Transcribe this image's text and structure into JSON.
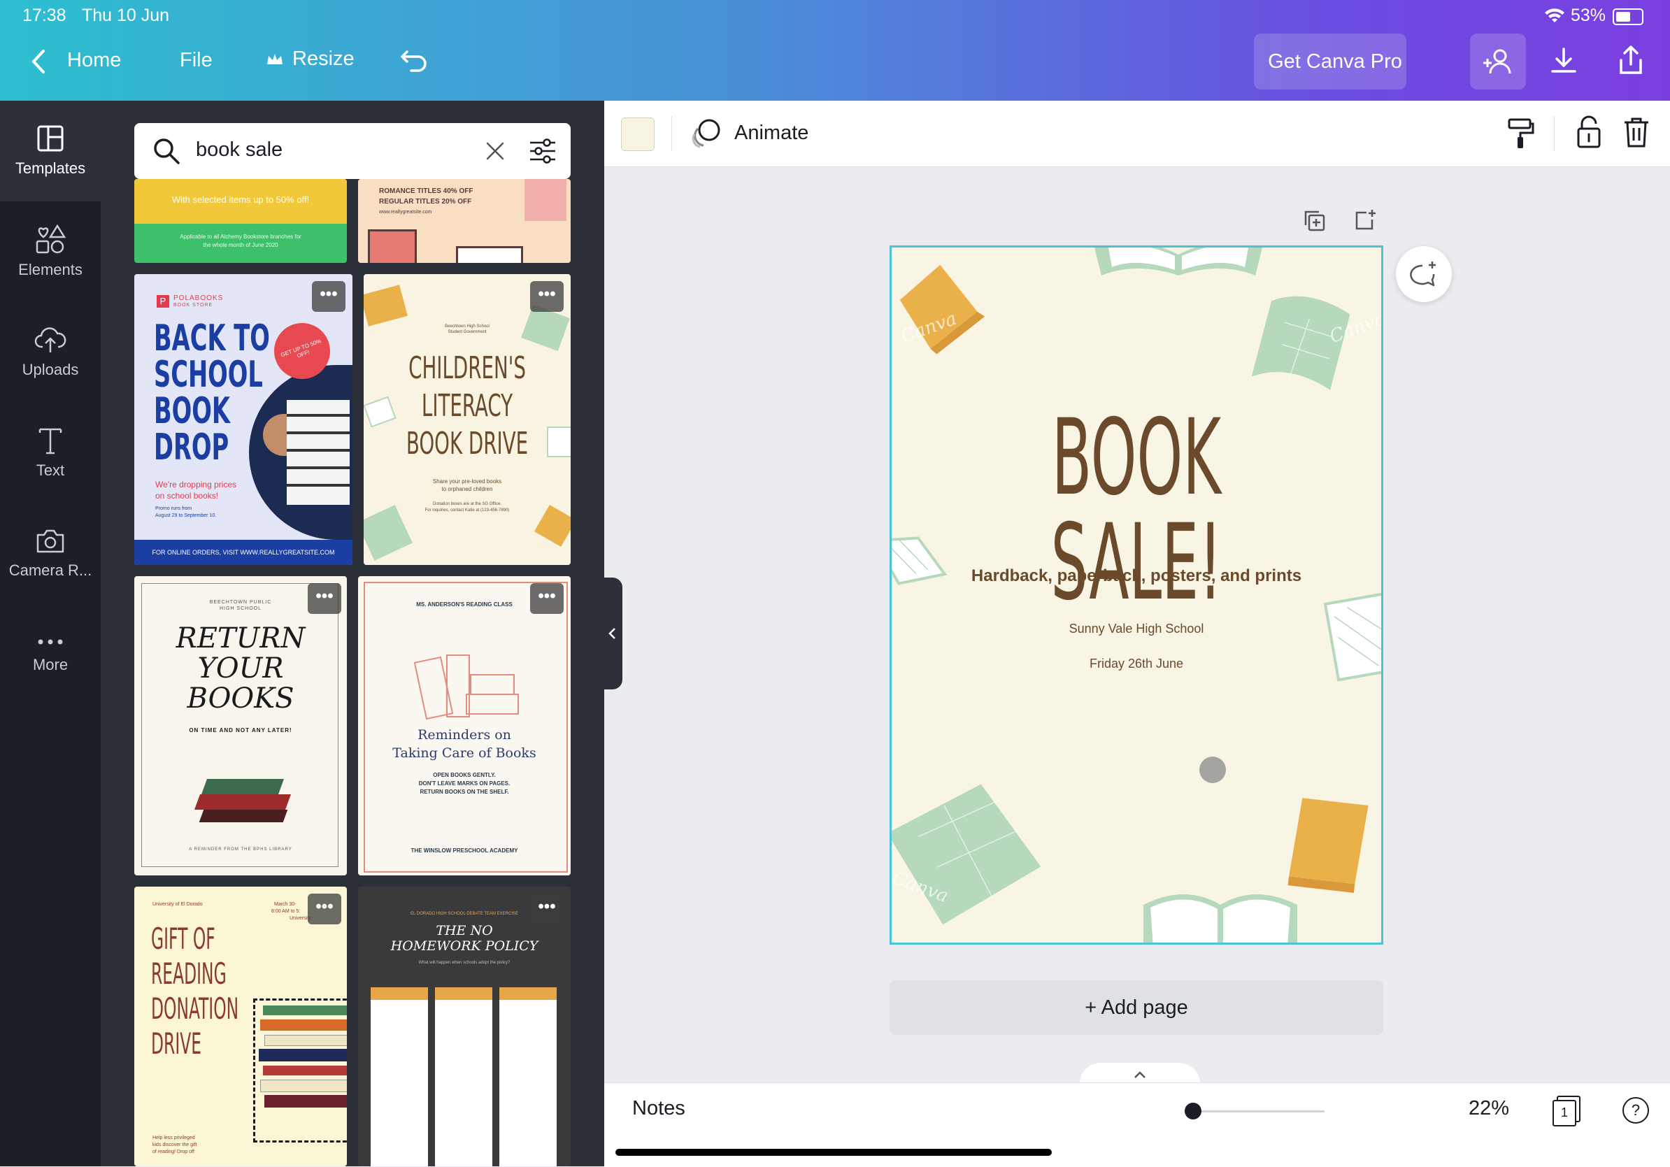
{
  "status": {
    "time": "17:38",
    "date": "Thu 10 Jun",
    "battery": "53%"
  },
  "nav": {
    "home": "Home",
    "file": "File",
    "resize": "Resize",
    "get_pro": "Get Canva Pro"
  },
  "sidebar": {
    "items": [
      {
        "label": "Templates",
        "icon": "templates-icon"
      },
      {
        "label": "Elements",
        "icon": "elements-icon"
      },
      {
        "label": "Uploads",
        "icon": "uploads-icon"
      },
      {
        "label": "Text",
        "icon": "text-icon"
      },
      {
        "label": "Camera R...",
        "icon": "camera-icon"
      },
      {
        "label": "More",
        "icon": "more-icon"
      }
    ]
  },
  "search": {
    "value": "book sale"
  },
  "templates": {
    "t0": {
      "line1": "With selected items up to 50% off!",
      "line2": "Applicable to all Alchemy Bookstore branches for",
      "line3": "the whole month of June 2020"
    },
    "t1": {
      "line1": "ROMANCE TITLES 40% OFF",
      "line2": "REGULAR TITLES 20% OFF",
      "line3": "www.reallygreatsite.com"
    },
    "t2": {
      "brand": "POLABOOKS",
      "brand_sub": "BOOK STORE",
      "title1": "BACK TO",
      "title2": "SCHOOL",
      "title3": "BOOK",
      "title4": "DROP",
      "badge": "GET UP TO 50% OFF!",
      "sub1": "We're dropping prices",
      "sub2": "on school books!",
      "promo1": "Promo runs from",
      "promo2": "August 29 to September 10.",
      "footer": "FOR ONLINE ORDERS, VISIT WWW.REALLYGREATSITE.COM"
    },
    "t3": {
      "org1": "Beechtown High School",
      "org2": "Student Government",
      "title1": "CHILDREN'S",
      "title2": "LITERACY",
      "title3": "BOOK DRIVE",
      "sub1": "Share your pre-loved books",
      "sub2": "to orphaned children",
      "info1": "Donation boxes are at the SG Office.",
      "info2": "For inquiries, contact Katie at (123-456-7890)"
    },
    "t4": {
      "org1": "BEECHTOWN PUBLIC",
      "org2": "HIGH SCHOOL",
      "title1": "RETURN",
      "title2": "YOUR",
      "title3": "BOOKS",
      "sub": "ON TIME AND NOT ANY LATER!",
      "footer": "A REMINDER FROM THE BPHS LIBRARY"
    },
    "t5": {
      "header": "MS. ANDERSON'S READING CLASS",
      "title1": "Reminders on",
      "title2": "Taking Care of Books",
      "r1": "OPEN BOOKS GENTLY.",
      "r2": "DON'T LEAVE MARKS ON PAGES.",
      "r3": "RETURN BOOKS ON THE SHELF.",
      "footer": "THE WINSLOW PRESCHOOL ACADEMY"
    },
    "t6": {
      "org": "University of El Dorado",
      "date1": "March 30-",
      "date2": "8:00 AM to 5:",
      "date3": "University",
      "title1": "GIFT OF",
      "title2": "READING",
      "title3": "DONATION",
      "title4": "DRIVE",
      "foot1": "Help less privileged",
      "foot2": "kids discover the gift",
      "foot3": "of reading! Drop off"
    },
    "t7": {
      "header": "EL DORADO HIGH SCHOOL DEBATE TEAM EXERCISE",
      "title1": "THE NO",
      "title2": "HOMEWORK POLICY",
      "sub": "What will happen when schools adopt the policy?"
    }
  },
  "toolbar": {
    "animate": "Animate",
    "bg_color": "#f6f3e2"
  },
  "poster": {
    "title": "BOOK SALE!",
    "subtitle": "Hardback, paperback, posters, and prints",
    "school": "Sunny Vale High School",
    "date": "Friday 26th June",
    "watermark": "Canva"
  },
  "add_page": "+ Add page",
  "bottom": {
    "notes": "Notes",
    "zoom": "22%",
    "page_count": "1",
    "help": "?"
  },
  "colors": {
    "accent": "#4fc3d6",
    "poster_bg": "#f9f5e5",
    "poster_title": "#6b4a2b",
    "book_orange": "#eab14a",
    "book_green": "#b6d8bd"
  }
}
